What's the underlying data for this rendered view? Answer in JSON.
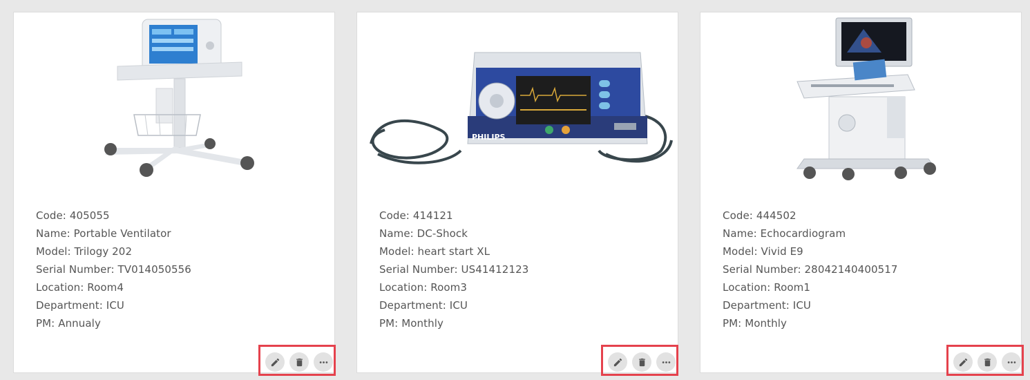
{
  "cards": [
    {
      "image_icon": "ventilator-image",
      "code": "Code: 405055",
      "name": "Name: Portable Ventilator",
      "model": "Model: Trilogy 202",
      "serial": "Serial Number: TV014050556",
      "location": "Location: Room4",
      "department": "Department: ICU",
      "pm": "PM: Annualy"
    },
    {
      "image_icon": "defibrillator-image",
      "brand_text": "PHILIPS",
      "code": "Code: 414121",
      "name": "Name: DC-Shock",
      "model": "Model: heart start XL",
      "serial": "Serial Number: US41412123",
      "location": "Location: Room3",
      "department": "Department: ICU",
      "pm": "PM: Monthly"
    },
    {
      "image_icon": "ultrasound-machine-image",
      "code": "Code: 444502",
      "name": "Name: Echocardiogram",
      "model": "Model: Vivid E9",
      "serial": "Serial Number: 28042140400517",
      "location": "Location: Room1",
      "department": "Department: ICU",
      "pm": "PM: Monthly"
    }
  ],
  "actions": [
    "edit-icon",
    "delete-icon",
    "more-icon"
  ],
  "colors": {
    "highlight": "#e5424d",
    "button_bg": "#e2e2e2",
    "icon": "#555555",
    "text": "#555555",
    "background": "#e8e8e8"
  }
}
